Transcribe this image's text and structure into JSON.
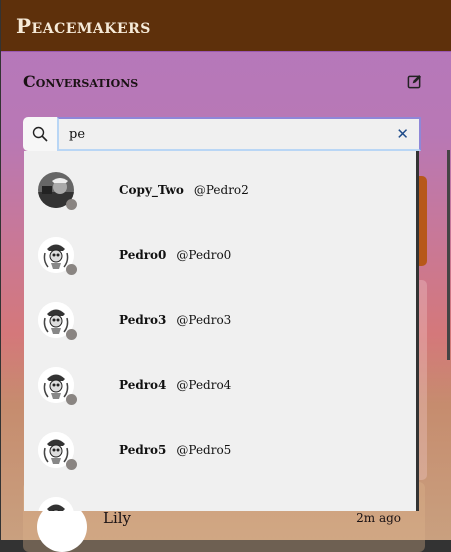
{
  "app": {
    "title": "Peacemakers"
  },
  "conversations": {
    "title": "Conversations",
    "compose_icon": "edit-icon"
  },
  "search": {
    "value": "pe",
    "placeholder": "",
    "clear_label": "✕"
  },
  "results": [
    {
      "name": "Copy_Two",
      "handle": "@Pedro2",
      "avatar": "photo",
      "status": "offline"
    },
    {
      "name": "Pedro0",
      "handle": "@Pedro0",
      "avatar": "skull",
      "status": "offline"
    },
    {
      "name": "Pedro3",
      "handle": "@Pedro3",
      "avatar": "skull",
      "status": "offline"
    },
    {
      "name": "Pedro4",
      "handle": "@Pedro4",
      "avatar": "skull",
      "status": "offline"
    },
    {
      "name": "Pedro5",
      "handle": "@Pedro5",
      "avatar": "skull",
      "status": "offline"
    },
    {
      "name": "",
      "handle": "",
      "avatar": "skull",
      "status": "offline"
    }
  ],
  "background_conversation": {
    "name": "Lily",
    "time": "2m ago"
  },
  "colors": {
    "header": "#5e300b",
    "status_offline": "#8a8582",
    "clear": "#1f4c8a"
  }
}
